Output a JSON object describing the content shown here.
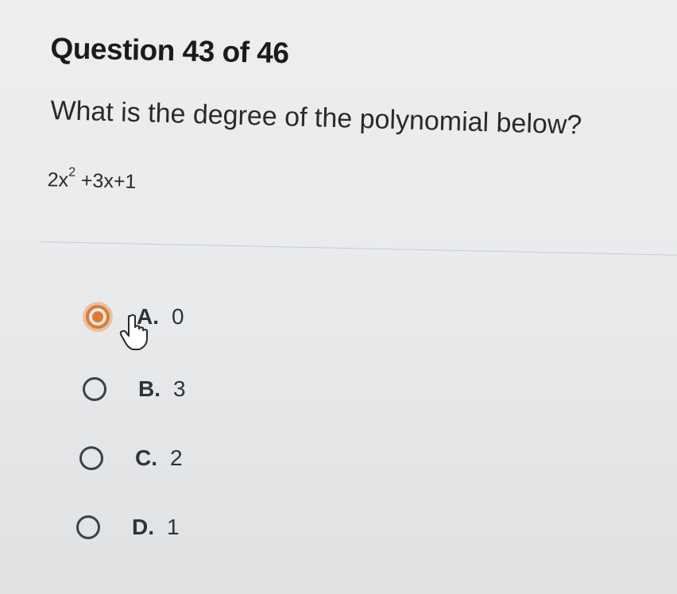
{
  "question": {
    "title": "Question 43 of 46",
    "prompt": "What is the degree of the polynomial below?",
    "expression": {
      "part1": "2x",
      "exponent": "2",
      "part2": " +3x+1"
    }
  },
  "options": [
    {
      "letter": "A.",
      "value": "0",
      "selected": true
    },
    {
      "letter": "B.",
      "value": "3",
      "selected": false
    },
    {
      "letter": "C.",
      "value": "2",
      "selected": false
    },
    {
      "letter": "D.",
      "value": "1",
      "selected": false
    }
  ],
  "colors": {
    "selected_accent": "#e07a2c",
    "radio_border": "#3c4147"
  },
  "icons": {
    "pointer": "hand-pointer-icon"
  }
}
